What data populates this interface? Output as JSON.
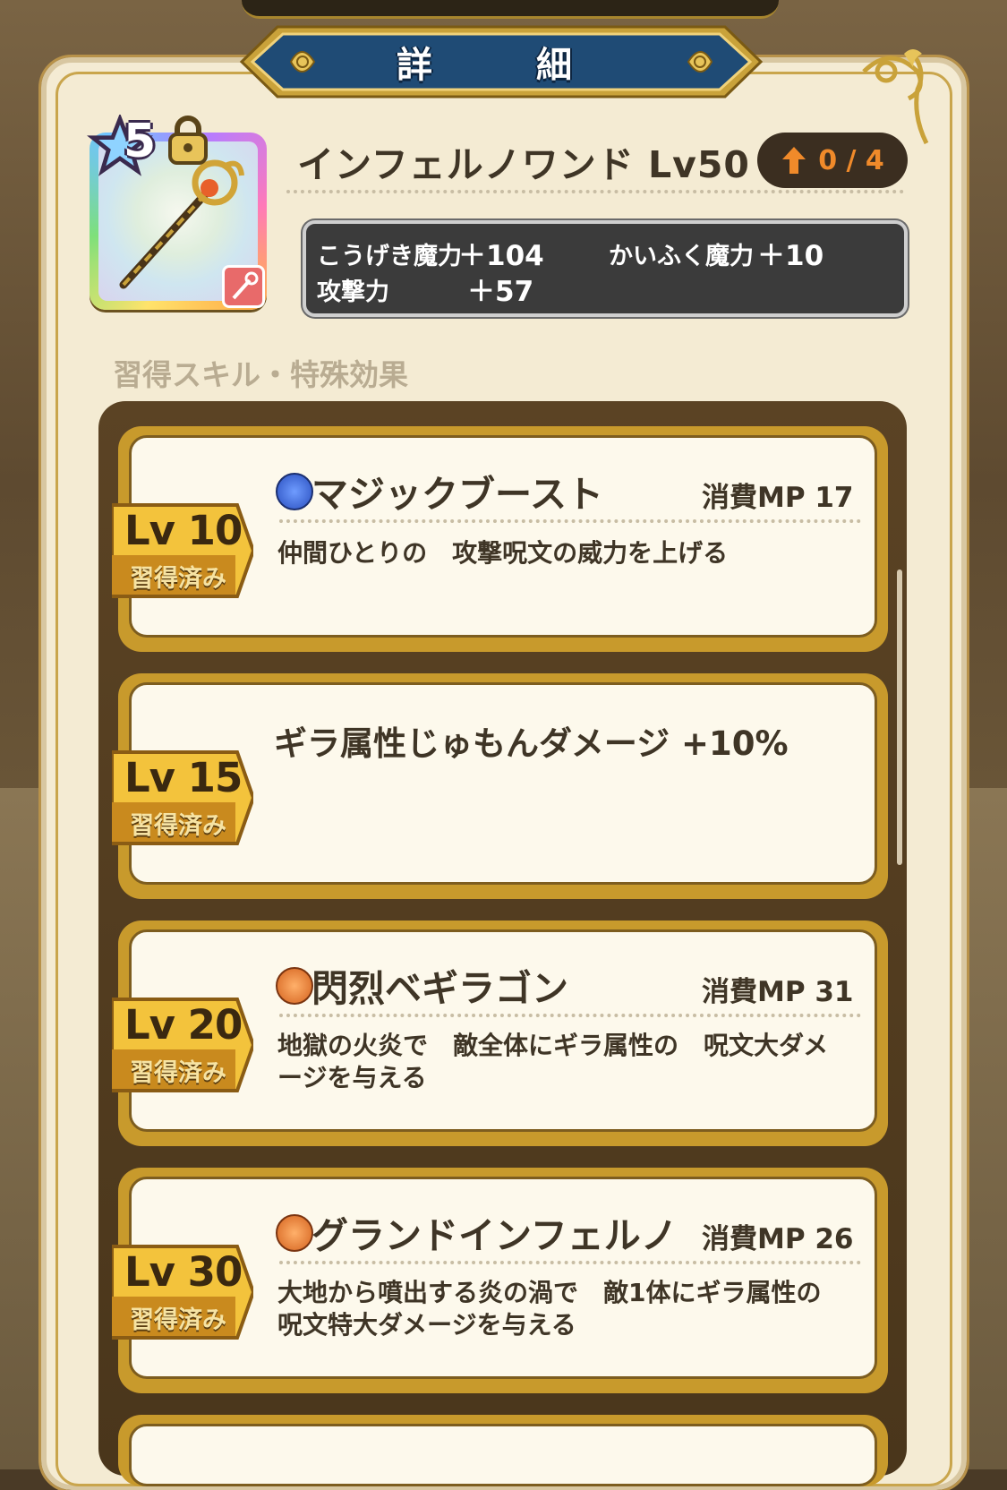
{
  "header": {
    "title": "詳　細"
  },
  "item": {
    "rarity_stars": "5",
    "name": "インフェルノワンド Lv50",
    "upgrade": "0 / 4",
    "stats": [
      {
        "label": "こうげき魔力",
        "value": "＋104"
      },
      {
        "label": "かいふく魔力",
        "value": "＋10"
      },
      {
        "label": "攻撃力",
        "value": "＋57"
      }
    ]
  },
  "section_label": "習得スキル・特殊効果",
  "skills": [
    {
      "level": "Lv 10",
      "status": "習得済み",
      "name": "マジックブースト",
      "mp": "消費MP 17",
      "desc": "仲間ひとりの　攻撃呪文の威力を上げる",
      "icon": "blue-magic-icon"
    },
    {
      "level": "Lv 15",
      "status": "習得済み",
      "name": "ギラ属性じゅもんダメージ +10%",
      "mp": "",
      "desc": "",
      "icon": ""
    },
    {
      "level": "Lv 20",
      "status": "習得済み",
      "name": "閃烈ベギラゴン",
      "mp": "消費MP 31",
      "desc": "地獄の火炎で　敵全体にギラ属性の　呪文大ダメージを与える",
      "icon": "fire-magic-icon"
    },
    {
      "level": "Lv 30",
      "status": "習得済み",
      "name": "グランドインフェルノ",
      "mp": "消費MP 26",
      "desc": "大地から噴出する炎の渦で　敵1体にギラ属性の呪文特大ダメージを与える",
      "icon": "fire-magic-icon"
    }
  ],
  "colors": {
    "accent_gold": "#c89a2c",
    "banner_blue": "#1f4b75",
    "panel_bg": "#f4ebd3"
  }
}
